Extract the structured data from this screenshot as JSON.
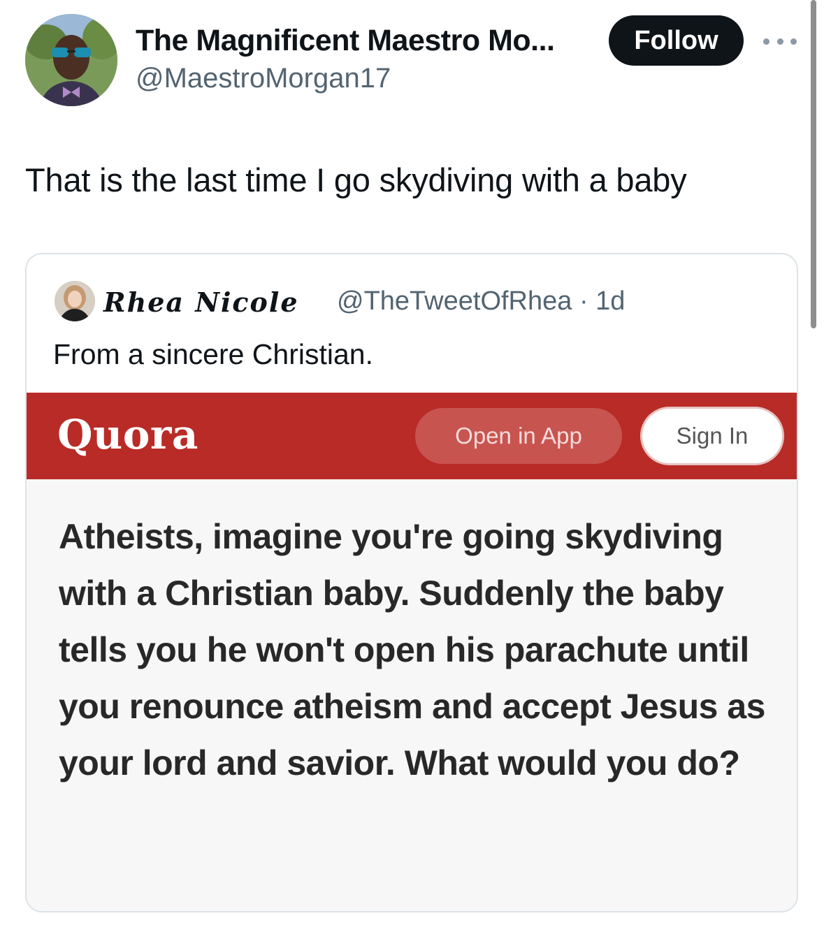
{
  "tweet": {
    "author": {
      "display_name": "The Magnificent Maestro Mo...",
      "handle": "@MaestroMorgan17"
    },
    "follow_label": "Follow",
    "text": "That is the last time I go skydiving with a baby"
  },
  "quoted_tweet": {
    "author_name": "Rhea Nicole",
    "meta": "@TheTweetOfRhea · 1d",
    "text": "From a sincere Christian.",
    "embed": {
      "brand": "Quora",
      "open_in_app_label": "Open in App",
      "sign_in_label": "Sign In",
      "question": "Atheists, imagine you're going skydiving with a Christian baby. Suddenly the baby tells you he won't open his parachute until you renounce atheism and accept Jesus as your lord and savior. What would you do?"
    }
  },
  "colors": {
    "quora_red": "#b92b27",
    "follow_bg": "#0f1419",
    "secondary_text": "#536471"
  },
  "icons": [
    "avatar-photo",
    "more-options-icon"
  ]
}
